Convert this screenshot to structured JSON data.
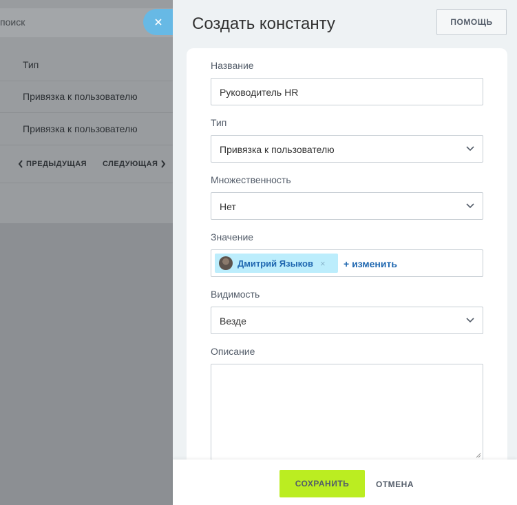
{
  "background_page": {
    "search_placeholder": "поиск",
    "rows": [
      "Тип",
      "Привязка к пользователю",
      "Привязка к пользователю"
    ],
    "pager": {
      "prev_label": "ПРЕДЫДУЩАЯ",
      "next_label": "СЛЕДУЮЩАЯ"
    }
  },
  "close_icon": "close-icon",
  "panel": {
    "title": "Создать константу",
    "help_label": "ПОМОЩЬ",
    "fields": {
      "name": {
        "label": "Название",
        "value": "Руководитель HR"
      },
      "type": {
        "label": "Тип",
        "value": "Привязка к пользователю"
      },
      "multiple": {
        "label": "Множественность",
        "value": "Нет"
      },
      "value": {
        "label": "Значение",
        "user": "Дмитрий Языков",
        "remove_glyph": "×",
        "change_label": "+ изменить"
      },
      "visibility": {
        "label": "Видимость",
        "value": "Везде"
      },
      "description": {
        "label": "Описание",
        "value": ""
      }
    },
    "footer": {
      "save_label": "СОХРАНИТЬ",
      "cancel_label": "ОТМЕНА"
    }
  },
  "colors": {
    "accent_save": "#bbed21",
    "close_button": "#67b9e5",
    "link": "#1f67b0",
    "tag_bg": "#bcedfc"
  }
}
